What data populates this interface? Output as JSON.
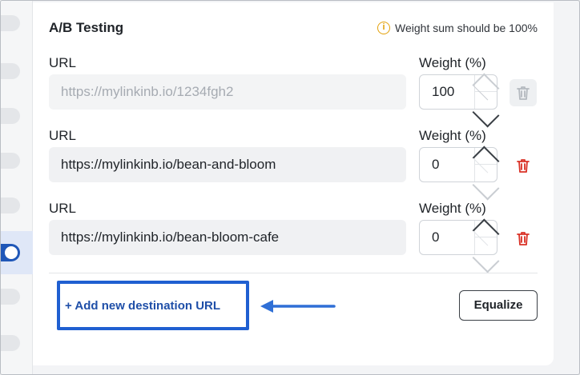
{
  "section": {
    "title": "A/B Testing",
    "warning": "Weight sum should be 100%"
  },
  "labels": {
    "url": "URL",
    "weight": "Weight (%)"
  },
  "rows": [
    {
      "url": "https://mylinkinb.io/1234fgh2",
      "weight": "100",
      "url_disabled": true,
      "delete_disabled": true
    },
    {
      "url": "https://mylinkinb.io/bean-and-bloom",
      "weight": "0",
      "url_disabled": false,
      "delete_disabled": false
    },
    {
      "url": "https://mylinkinb.io/bean-bloom-cafe",
      "weight": "0",
      "url_disabled": false,
      "delete_disabled": false
    }
  ],
  "actions": {
    "add_label": "+ Add new destination URL",
    "equalize_label": "Equalize"
  },
  "colors": {
    "accent": "#1f5fd1",
    "danger": "#d93025",
    "warning": "#e3a008"
  }
}
